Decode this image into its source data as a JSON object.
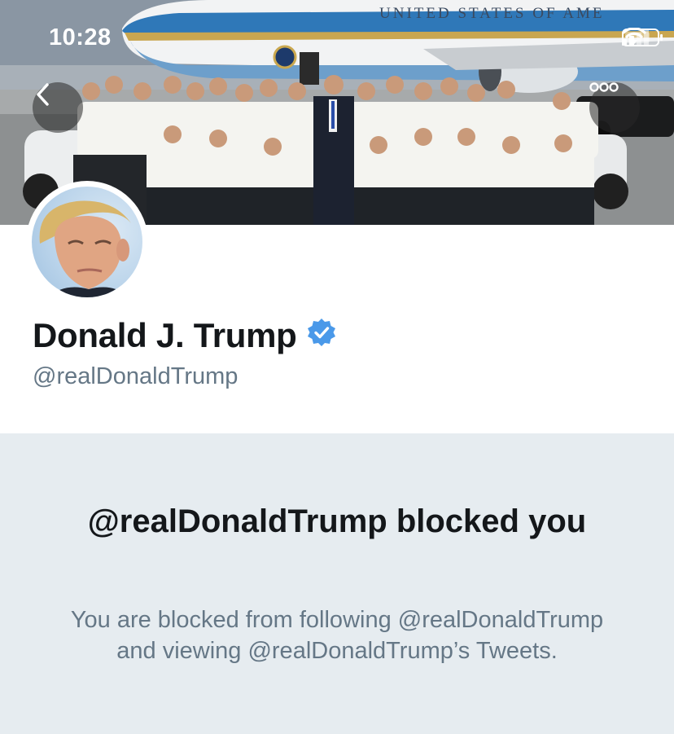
{
  "status_bar": {
    "time": "10:28"
  },
  "banner": {
    "aircraft_text": "UNITED STATES OF AMERICA"
  },
  "profile": {
    "display_name": "Donald J. Trump",
    "handle": "@realDonaldTrump",
    "verified": true
  },
  "blocked_notice": {
    "title": "@realDonaldTrump blocked you",
    "description": "You are blocked from following @realDonaldTrump and viewing @realDonaldTrump’s Tweets."
  },
  "icons": {
    "back": "chevron-left-icon",
    "more": "more-options-icon",
    "verified": "verified-badge-icon",
    "signal": "signal-icon",
    "wifi": "wifi-icon",
    "battery": "battery-icon"
  },
  "colors": {
    "verified_blue": "#4a99e9",
    "text_primary": "#14171a",
    "text_secondary": "#657786",
    "panel_background": "#e6ecf0"
  }
}
